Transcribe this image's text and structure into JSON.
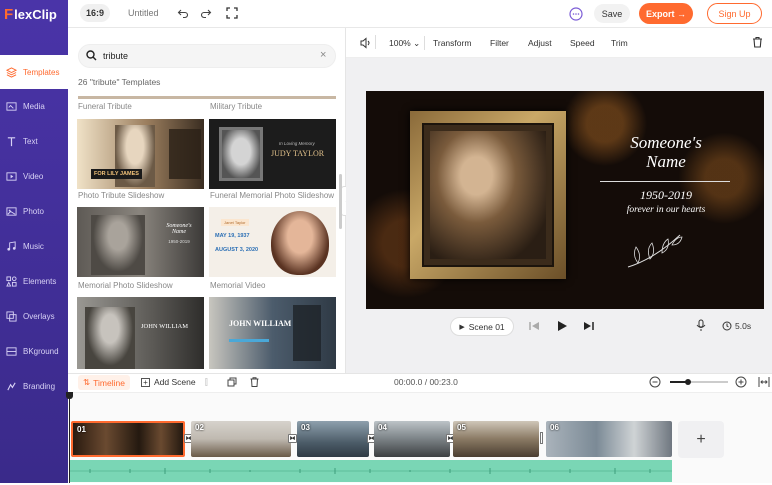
{
  "app": {
    "logo_f": "F",
    "logo_rest": "lexClip"
  },
  "topbar": {
    "ratio": "16:9",
    "title": "Untitled",
    "save": "Save",
    "export": "Export →",
    "signup": "Sign Up"
  },
  "sidebar": {
    "items": [
      {
        "label": "Templates",
        "icon": "templates-icon"
      },
      {
        "label": "Media",
        "icon": "media-icon"
      },
      {
        "label": "Text",
        "icon": "text-icon"
      },
      {
        "label": "Video",
        "icon": "video-icon"
      },
      {
        "label": "Photo",
        "icon": "photo-icon"
      },
      {
        "label": "Music",
        "icon": "music-icon"
      },
      {
        "label": "Elements",
        "icon": "elements-icon"
      },
      {
        "label": "Overlays",
        "icon": "overlays-icon"
      },
      {
        "label": "BKground",
        "icon": "background-icon"
      },
      {
        "label": "Branding",
        "icon": "branding-icon"
      }
    ]
  },
  "search": {
    "value": "tribute"
  },
  "results": {
    "count_text": "26 \"tribute\" Templates"
  },
  "templates": {
    "top_labels": [
      "Funeral Tribute",
      "Military Tribute"
    ],
    "items": [
      {
        "label": "Photo Tribute Slideshow",
        "caption": "FOR LILY JAMES"
      },
      {
        "label": "Funeral Memorial Photo Slideshow",
        "caption": "JUDY TAYLOR",
        "sub": "In Loving Memory"
      },
      {
        "label": "Memorial Photo Slideshow",
        "caption": "Someone's Name",
        "sub": "1950-2019"
      },
      {
        "label": "Memorial Video",
        "caption": "MAY 19, 1937",
        "sub": "AUGUST 3, 2020",
        "small": "Janet Taylor"
      },
      {
        "label": "",
        "caption": "JOHN WILLIAM"
      },
      {
        "label": "",
        "caption": "JOHN WILLIAM"
      }
    ]
  },
  "editor": {
    "zoom": "100%",
    "tools": [
      "Transform",
      "Filter",
      "Adjust",
      "Speed",
      "Trim"
    ],
    "preview": {
      "name_line1": "Someone's",
      "name_line2": "Name",
      "years": "1950-2019",
      "tagline": "forever in our hearts"
    },
    "scene": "Scene 01",
    "duration": "5.0s"
  },
  "timeline": {
    "label": "Timeline",
    "add_scene": "Add Scene",
    "time": "00:00.0 / 00:23.0",
    "clips": [
      "01",
      "02",
      "03",
      "04",
      "05",
      "06"
    ],
    "add_label": "+"
  },
  "colors": {
    "accent": "#ff6a2f",
    "sidebar": "#3d2f8f",
    "audio": "#7ad6b5"
  }
}
